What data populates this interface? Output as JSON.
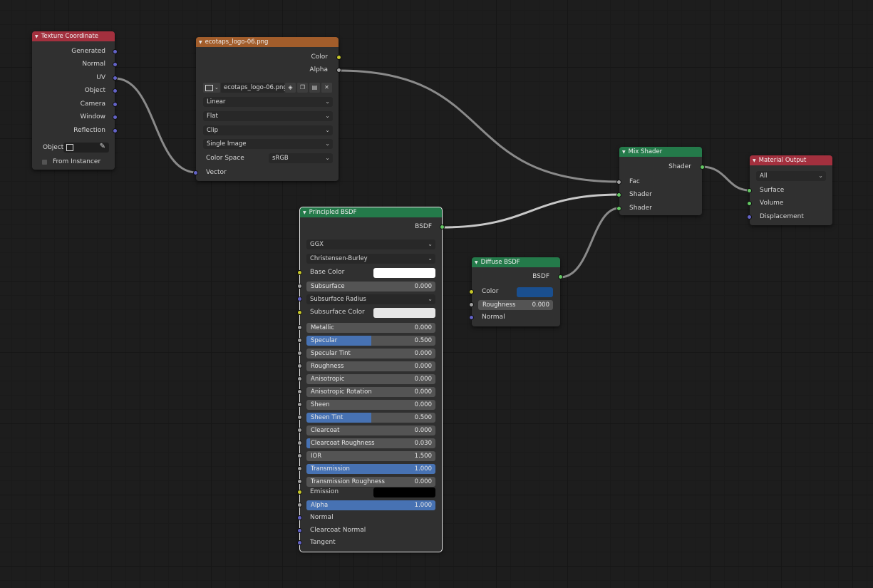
{
  "texture_coordinate": {
    "title": "Texture Coordinate",
    "outputs": [
      "Generated",
      "Normal",
      "UV",
      "Object",
      "Camera",
      "Window",
      "Reflection"
    ],
    "object_label": "Object:",
    "from_instancer_label": "From Instancer"
  },
  "image_texture": {
    "title": "ecotaps_logo-06.png",
    "outputs": [
      "Color",
      "Alpha"
    ],
    "image_name": "ecotaps_logo-06.png",
    "interpolation": "Linear",
    "projection": "Flat",
    "extension": "Clip",
    "source": "Single Image",
    "color_space_label": "Color Space",
    "color_space_value": "sRGB",
    "vector_label": "Vector"
  },
  "principled": {
    "title": "Principled BSDF",
    "output": "BSDF",
    "distribution": "GGX",
    "subsurface_method": "Christensen-Burley",
    "base_color_label": "Base Color",
    "subsurface_label": "Subsurface",
    "subsurface_value": "0.000",
    "subsurface_radius_label": "Subsurface Radius",
    "subsurface_color_label": "Subsurface Color",
    "sliders": [
      {
        "label": "Metallic",
        "value": "0.000",
        "fill": 0
      },
      {
        "label": "Specular",
        "value": "0.500",
        "fill": 0.5
      },
      {
        "label": "Specular Tint",
        "value": "0.000",
        "fill": 0
      },
      {
        "label": "Roughness",
        "value": "0.000",
        "fill": 0
      },
      {
        "label": "Anisotropic",
        "value": "0.000",
        "fill": 0
      },
      {
        "label": "Anisotropic Rotation",
        "value": "0.000",
        "fill": 0
      },
      {
        "label": "Sheen",
        "value": "0.000",
        "fill": 0
      },
      {
        "label": "Sheen Tint",
        "value": "0.500",
        "fill": 0.5
      },
      {
        "label": "Clearcoat",
        "value": "0.000",
        "fill": 0
      },
      {
        "label": "Clearcoat Roughness",
        "value": "0.030",
        "fill": 0.03
      },
      {
        "label": "IOR",
        "value": "1.500",
        "fill": 0
      },
      {
        "label": "Transmission",
        "value": "1.000",
        "fill": 1
      },
      {
        "label": "Transmission Roughness",
        "value": "0.000",
        "fill": 0
      }
    ],
    "emission_label": "Emission",
    "alpha_label": "Alpha",
    "alpha_value": "1.000",
    "alpha_fill": 1,
    "normal_label": "Normal",
    "clearcoat_normal_label": "Clearcoat Normal",
    "tangent_label": "Tangent",
    "base_color": "#ffffff",
    "subsurface_color": "#e6e6e6",
    "emission_color": "#000000"
  },
  "diffuse": {
    "title": "Diffuse BSDF",
    "output": "BSDF",
    "color_label": "Color",
    "color": "#1a4f8f",
    "roughness_label": "Roughness",
    "roughness_value": "0.000",
    "normal_label": "Normal"
  },
  "mix": {
    "title": "Mix Shader",
    "output": "Shader",
    "inputs": [
      "Fac",
      "Shader",
      "Shader"
    ]
  },
  "material_output": {
    "title": "Material Output",
    "target": "All",
    "inputs": [
      "Surface",
      "Volume",
      "Displacement"
    ]
  },
  "colors": {
    "input_header": "#a3303e",
    "texture_header": "#a25d2b",
    "shader_header": "#247a4a",
    "slider_fill": "#4772b3"
  }
}
